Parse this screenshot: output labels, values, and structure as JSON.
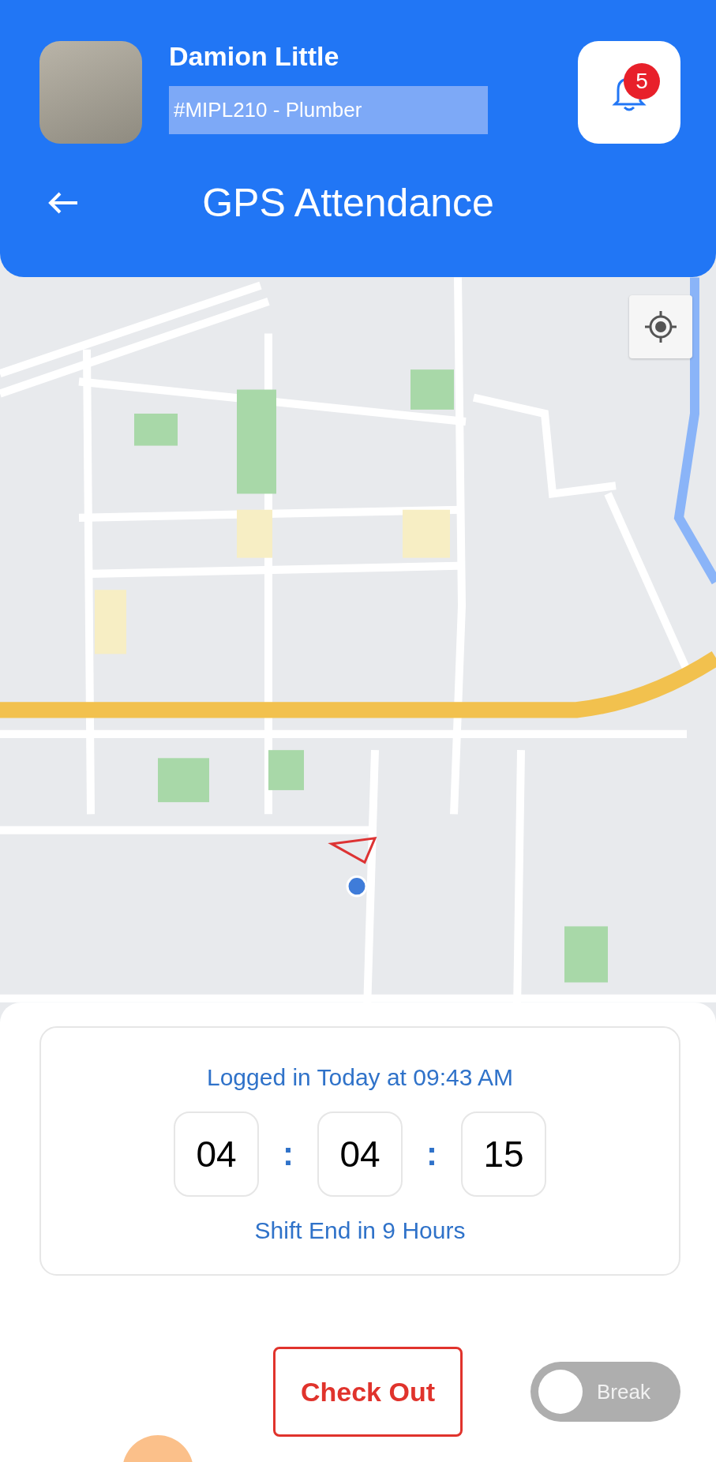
{
  "user": {
    "name": "Damion Little",
    "employee_tag": "#MIPL210 - Plumber"
  },
  "notifications": {
    "count": "5"
  },
  "title": "GPS Attendance",
  "session": {
    "login_text": "Logged in Today at 09:43 AM",
    "timer_parts": [
      {
        "kind": "digits",
        "text": "04"
      },
      {
        "kind": "separator",
        "text": ":"
      },
      {
        "kind": "digits",
        "text": "04"
      },
      {
        "kind": "separator",
        "text": ":"
      },
      {
        "kind": "digits",
        "text": "15"
      }
    ],
    "shift_text": "Shift End in 9 Hours"
  },
  "actions": {
    "check_out": "Check Out",
    "break_toggle": {
      "label": "Break",
      "on": false
    }
  }
}
